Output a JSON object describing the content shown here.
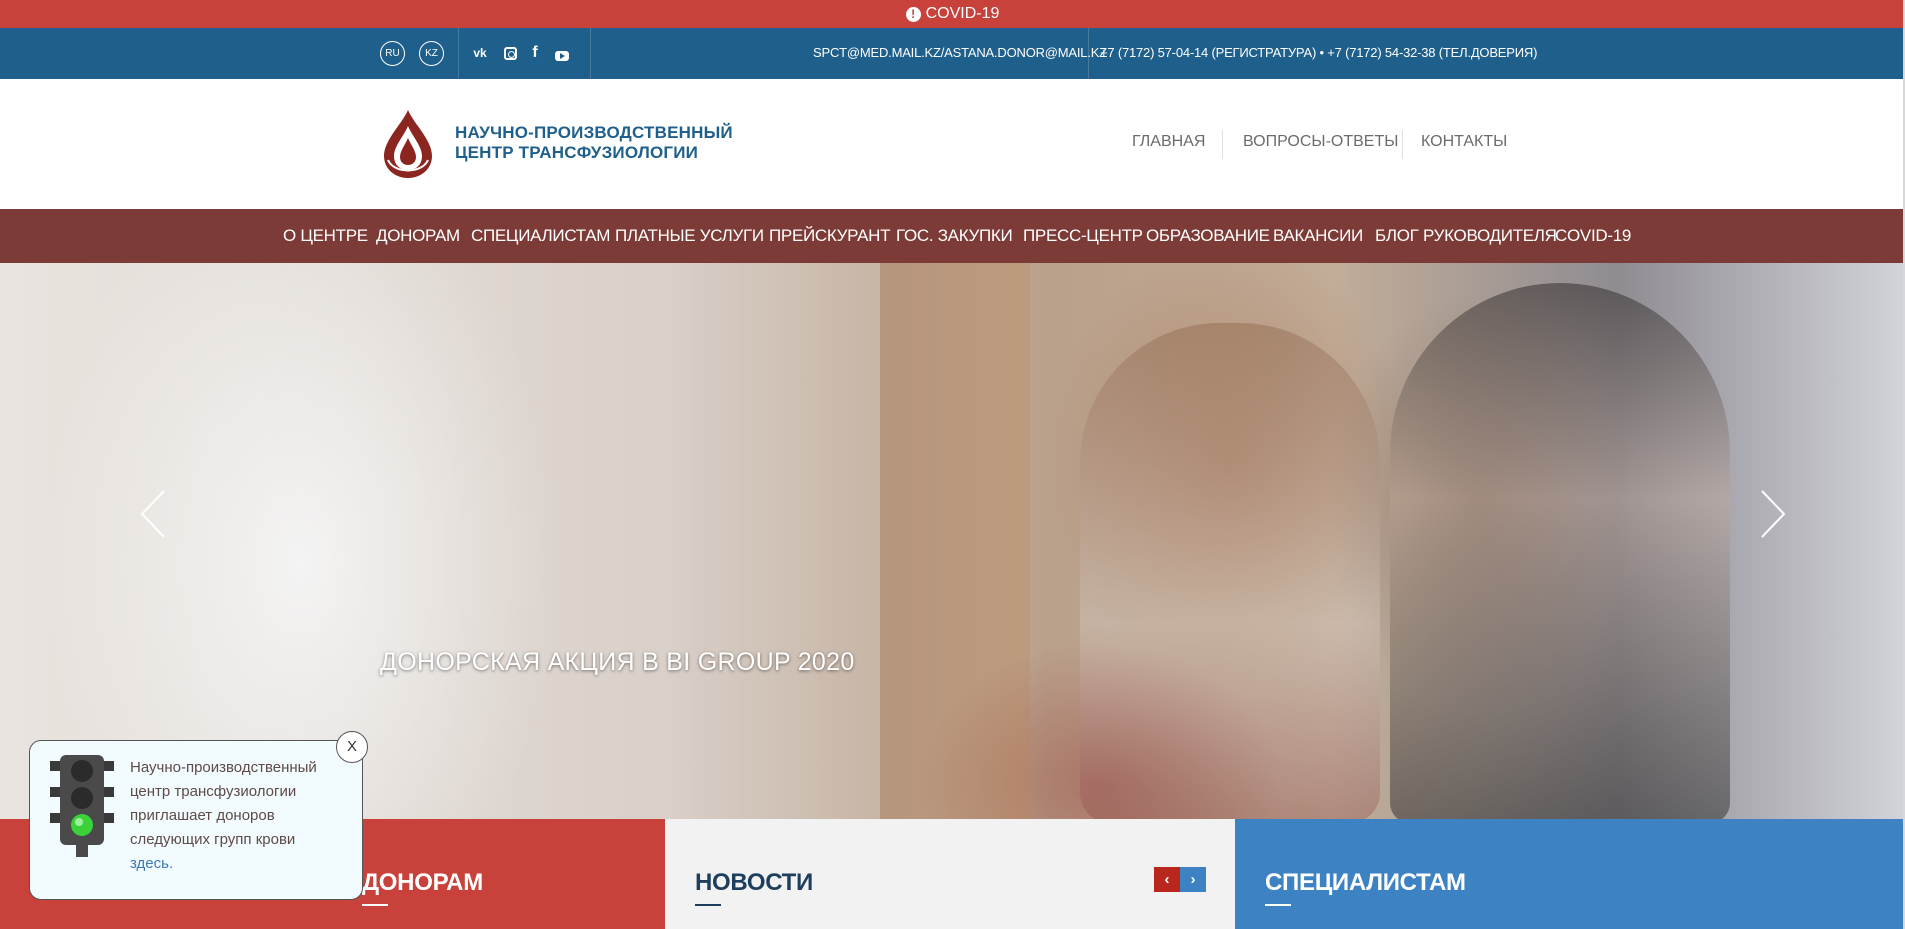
{
  "covid_banner": {
    "label": "COVID-19",
    "icon": "alert-circle-icon"
  },
  "topbar": {
    "languages": [
      "RU",
      "KZ"
    ],
    "social": [
      "vk-icon",
      "instagram-icon",
      "facebook-icon",
      "youtube-icon"
    ],
    "email": "SPCT@MED.MAIL.KZ/ASTANA.DONOR@MAIL.KZ",
    "phones": "+7 (7172) 57-04-14 (РЕГИСТРАТУРА) • +7 (7172) 54-32-38 (ТЕЛ.ДОВЕРИЯ)"
  },
  "header": {
    "logo_line1": "НАУЧНО-ПРОИЗВОДСТВЕННЫЙ",
    "logo_line2": "ЦЕНТР ТРАНСФУЗИОЛОГИИ",
    "links": [
      "ГЛАВНАЯ",
      "ВОПРОСЫ-ОТВЕТЫ",
      "КОНТАКТЫ"
    ]
  },
  "nav": {
    "items": [
      "О ЦЕНТРЕ",
      "ДОНОРАМ",
      "СПЕЦИАЛИСТАМ",
      "ПЛАТНЫЕ УСЛУГИ",
      "ПРЕЙСКУРАНТ",
      "ГОС. ЗАКУПКИ",
      "ПРЕСС-ЦЕНТР",
      "ОБРАЗОВАНИЕ",
      "ВАКАНСИИ",
      "БЛОГ РУКОВОДИТЕЛЯ",
      "COVID-19"
    ]
  },
  "hero": {
    "caption": "ДОНОРСКАЯ АКЦИЯ В BI GROUP 2020"
  },
  "columns": {
    "donors": "ДОНОРАМ",
    "news": "НОВОСТИ",
    "news_prev": "‹",
    "news_next": "›",
    "specialists": "СПЕЦИАЛИСТАМ"
  },
  "popup": {
    "text": "Научно-производственный центр трансфузиологии приглашает доноров следующих групп крови",
    "link": "здесь.",
    "close": "X"
  },
  "colors": {
    "covid_red": "#c8413a",
    "topbar_blue": "#1f5f8b",
    "nav_brown": "#7c3b36",
    "specialists_blue": "#3d82c3",
    "logo_blue": "#1f5f8b",
    "logo_red": "#8b2520"
  }
}
